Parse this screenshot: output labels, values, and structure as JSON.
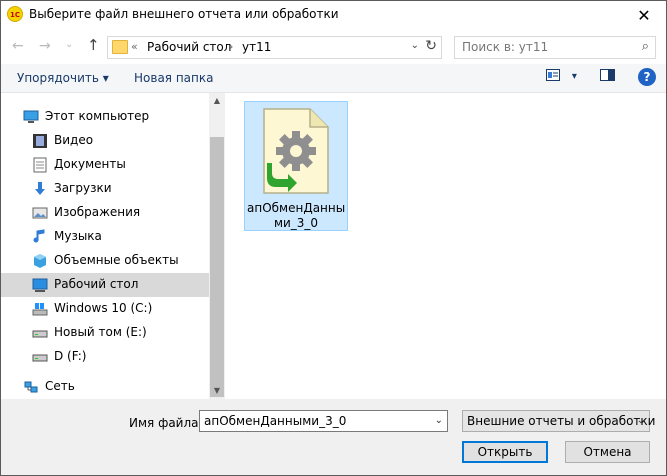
{
  "window": {
    "title": "Выберите файл внешнего отчета или обработки",
    "logo": "1С",
    "close": "✕"
  },
  "nav": {
    "back": "←",
    "forward": "→",
    "recent": "⌄",
    "up": "↑",
    "breadcrumb": {
      "prefix": "«",
      "items": [
        "Рабочий стол",
        "ут11"
      ],
      "separator": "›"
    },
    "dropdown": "⌄",
    "refresh": "↻",
    "search_placeholder": "Поиск в: ут11",
    "search_glyph": "⌕"
  },
  "toolbar": {
    "organize": "Упорядочить",
    "organize_arrow": "▾",
    "new_folder": "Новая папка",
    "view_arrow": "▾",
    "help": "?"
  },
  "sidebar": {
    "items": [
      {
        "label": "Этот компьютер",
        "icon": "computer-icon"
      },
      {
        "label": "Видео",
        "icon": "video-icon"
      },
      {
        "label": "Документы",
        "icon": "documents-icon"
      },
      {
        "label": "Загрузки",
        "icon": "downloads-icon"
      },
      {
        "label": "Изображения",
        "icon": "pictures-icon"
      },
      {
        "label": "Музыка",
        "icon": "music-icon"
      },
      {
        "label": "Объемные объекты",
        "icon": "3d-objects-icon"
      },
      {
        "label": "Рабочий стол",
        "icon": "desktop-icon"
      },
      {
        "label": "Windows 10 (C:)",
        "icon": "windows-drive-icon"
      },
      {
        "label": "Новый том (E:)",
        "icon": "drive-icon"
      },
      {
        "label": "D (F:)",
        "icon": "drive-icon"
      },
      {
        "label": "Сеть",
        "icon": "network-icon"
      }
    ],
    "selected": "Рабочий стол",
    "scroll_up": "▲",
    "scroll_down": "▼"
  },
  "files": [
    {
      "name_line1": "апОбменДанны",
      "name_line2": "ми_3_0",
      "icon": "data-processor-file-icon"
    }
  ],
  "footer": {
    "filename_label": "Имя файла:",
    "filename_value": "апОбменДанными_3_0",
    "filter_value": "Внешние отчеты и обработки",
    "dropdown": "⌄",
    "open_button": "Открыть",
    "cancel_button": "Отмена"
  },
  "colors": {
    "selection": "#cce8ff",
    "selection_border": "#99d1ff",
    "accent": "#0078d7",
    "nav_selected": "#d9d9d9"
  }
}
